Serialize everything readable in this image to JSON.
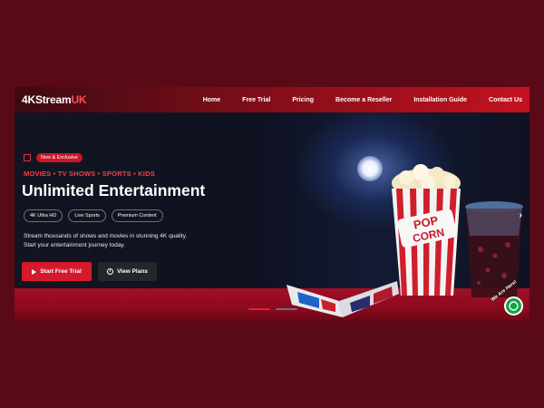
{
  "nav": {
    "logo_main": "4KStream",
    "logo_accent": "UK",
    "items": [
      {
        "label": "Home"
      },
      {
        "label": "Free Trial"
      },
      {
        "label": "Pricing"
      },
      {
        "label": "Become a Reseller"
      },
      {
        "label": "Installation Guide"
      },
      {
        "label": "Contact Us"
      }
    ]
  },
  "hero": {
    "badge": "New & Exclusive",
    "categories": "MOVIES • TV SHOWS • SPORTS • KIDS",
    "title": "Unlimited Entertainment",
    "pills": [
      "4K Ultra HD",
      "Live Sports",
      "Premium Content"
    ],
    "description_line1": "Stream thousands of shows and movies in stunning 4K quality.",
    "description_line2": "Start your entertainment journey today.",
    "primary_button": "Start Free Trial",
    "secondary_button": "View Plans",
    "popcorn_text_1": "POP",
    "popcorn_text_2": "CORN",
    "slides_total": 2,
    "slide_active": 1
  },
  "chat": {
    "label": "We Are Here!"
  },
  "colors": {
    "page_bg": "#5a0a16",
    "accent_red": "#d5192c",
    "chat_green": "#15a34a"
  }
}
